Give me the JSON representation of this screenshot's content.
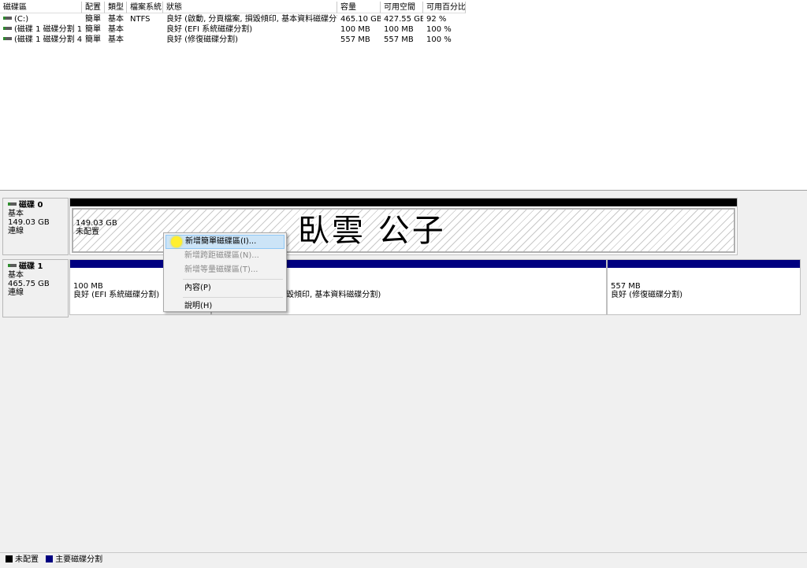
{
  "columns": [
    "磁碟區",
    "配置",
    "類型",
    "檔案系統",
    "狀態",
    "容量",
    "可用空間",
    "可用百分比"
  ],
  "volumes": [
    {
      "name": "(C:)",
      "layout": "簡單",
      "type": "基本",
      "fs": "NTFS",
      "status": "良好 (啟動, 分頁檔案, 損毀傾印, 基本資料磁碟分割)",
      "capacity": "465.10 GB",
      "free": "427.55 GB",
      "pct": "92 %"
    },
    {
      "name": "(磁碟 1 磁碟分割 1)",
      "layout": "簡單",
      "type": "基本",
      "fs": "",
      "status": "良好 (EFI 系統磁碟分割)",
      "capacity": "100 MB",
      "free": "100 MB",
      "pct": "100 %"
    },
    {
      "name": "(磁碟 1 磁碟分割 4)",
      "layout": "簡單",
      "type": "基本",
      "fs": "",
      "status": "良好 (修復磁碟分割)",
      "capacity": "557 MB",
      "free": "557 MB",
      "pct": "100 %"
    }
  ],
  "disks": [
    {
      "name": "磁碟 0",
      "type": "基本",
      "size": "149.03 GB",
      "state": "連線",
      "partitions": [
        {
          "size": "149.03 GB",
          "label": "未配置"
        }
      ]
    },
    {
      "name": "磁碟 1",
      "type": "基本",
      "size": "465.75 GB",
      "state": "連線",
      "partitions": [
        {
          "size": "100 MB",
          "label": "良好 (EFI 系統磁碟分割)"
        },
        {
          "size": "",
          "label": "毀傾印, 基本資料磁碟分割)"
        },
        {
          "size": "557 MB",
          "label": "良好 (修復磁碟分割)"
        }
      ]
    }
  ],
  "watermark": "臥雲 公子",
  "context_menu": [
    {
      "label": "新增簡單磁碟區(I)...",
      "state": "highlighted"
    },
    {
      "label": "新增跨距磁碟區(N)...",
      "state": "disabled"
    },
    {
      "label": "新增等量磁碟區(T)...",
      "state": "disabled"
    },
    {
      "label": "內容(P)",
      "state": "normal"
    },
    {
      "label": "說明(H)",
      "state": "normal"
    }
  ],
  "legend": [
    {
      "label": "未配置",
      "color": "#000000"
    },
    {
      "label": "主要磁碟分割",
      "color": "#000080"
    }
  ],
  "colors": {
    "unallocated": "#000000",
    "primary": "#000080"
  }
}
